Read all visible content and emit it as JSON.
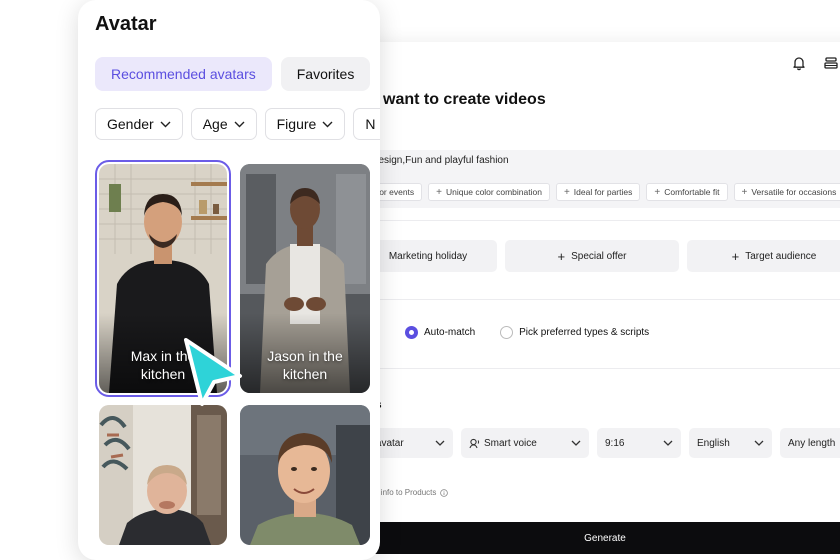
{
  "app": {
    "heading": "ou want to create videos",
    "description": "ng design,Fun and playful fashion",
    "chips": [
      "for events",
      "Unique color combination",
      "Ideal for parties",
      "Comfortable fit",
      "Versatile for occasions"
    ],
    "tags": [
      "Marketing holiday",
      "Special offer",
      "Target audience"
    ],
    "script_label": "es",
    "radio_options": [
      {
        "label": "Auto-match",
        "selected": true
      },
      {
        "label": "Pick preferred types & scripts",
        "selected": false
      }
    ],
    "settings_title": "ings",
    "selects": {
      "avatar": "rt avatar",
      "voice": "Smart voice",
      "ratio": "9:16",
      "language": "English",
      "length": "Any length"
    },
    "product_note": "oduct info to Products",
    "generate_label": "Generate"
  },
  "panel": {
    "title": "Avatar",
    "tabs": [
      "Recommended avatars",
      "Favorites"
    ],
    "filters": [
      "Gender",
      "Age",
      "Figure",
      "N"
    ],
    "cards": [
      {
        "label_line1": "Max in the",
        "label_line2": "kitchen",
        "selected": true
      },
      {
        "label_line1": "Jason in the",
        "label_line2": "kitchen",
        "selected": false
      },
      {
        "label_line1": "",
        "label_line2": "",
        "selected": false
      },
      {
        "label_line1": "",
        "label_line2": "",
        "selected": false
      }
    ]
  },
  "colors": {
    "accent": "#5b4fe0",
    "cursor": "#2ed3d8",
    "generate_bg": "#0c0c0e"
  }
}
